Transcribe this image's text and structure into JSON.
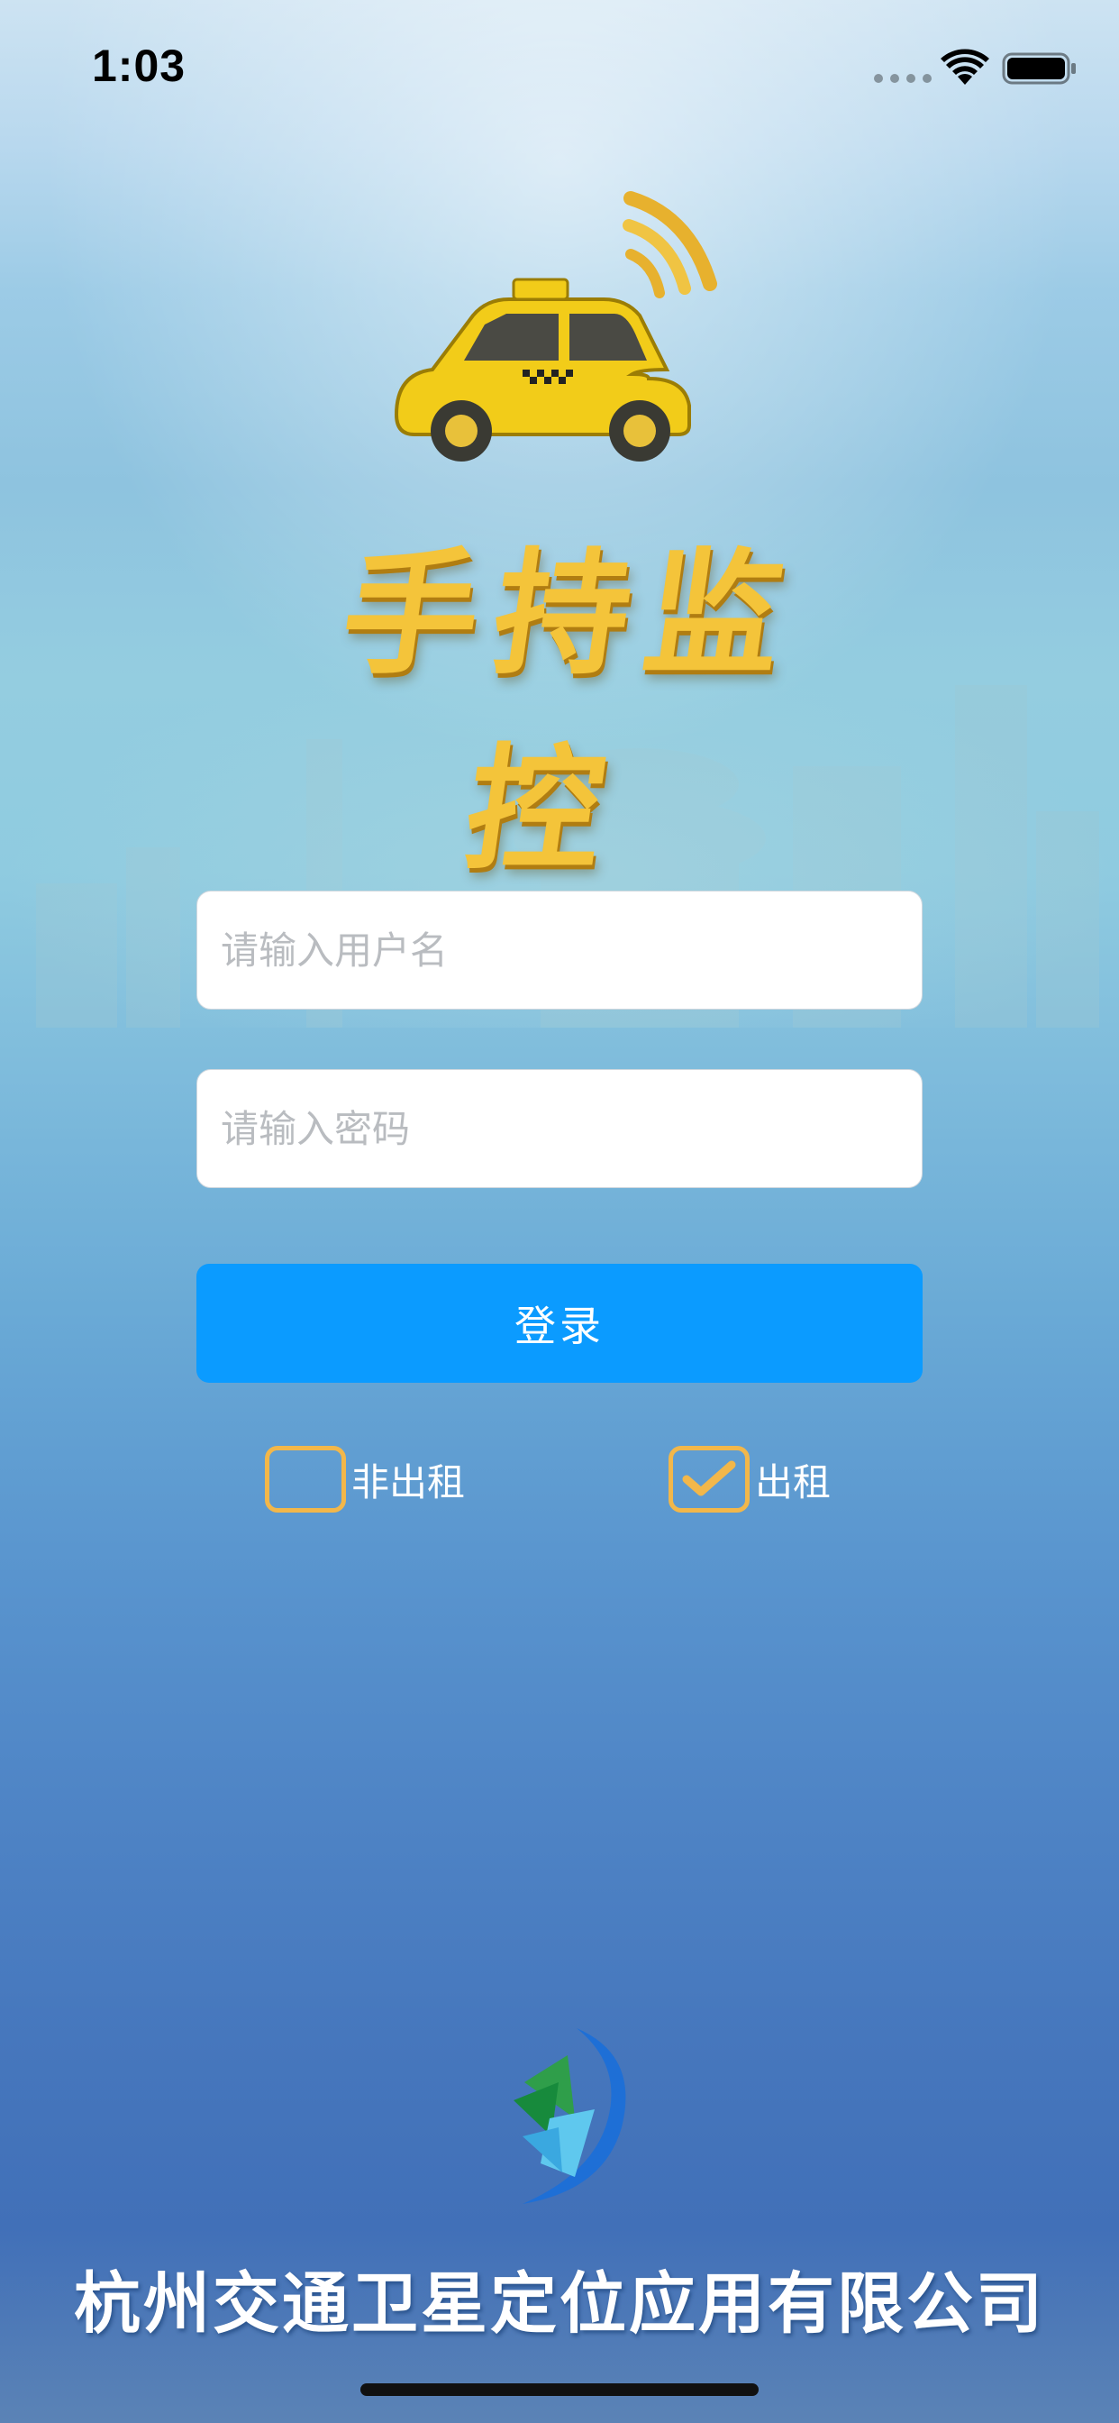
{
  "status_bar": {
    "time": "1:03"
  },
  "app": {
    "title": "手持监控"
  },
  "login_form": {
    "username_placeholder": "请输入用户名",
    "password_placeholder": "请输入密码",
    "login_label": "登录"
  },
  "options": [
    {
      "label": "非出租",
      "checked": false
    },
    {
      "label": "出租",
      "checked": true
    }
  ],
  "footer": {
    "company_name": "杭州交通卫星定位应用有限公司"
  },
  "colors": {
    "accent_button": "#0b9bff",
    "checkbox_border": "#f2b74a",
    "title_gold": "#f4c43a"
  },
  "icons": [
    "taxi-icon",
    "wifi-signal-icon",
    "company-logo-icon",
    "checkmark-icon"
  ]
}
